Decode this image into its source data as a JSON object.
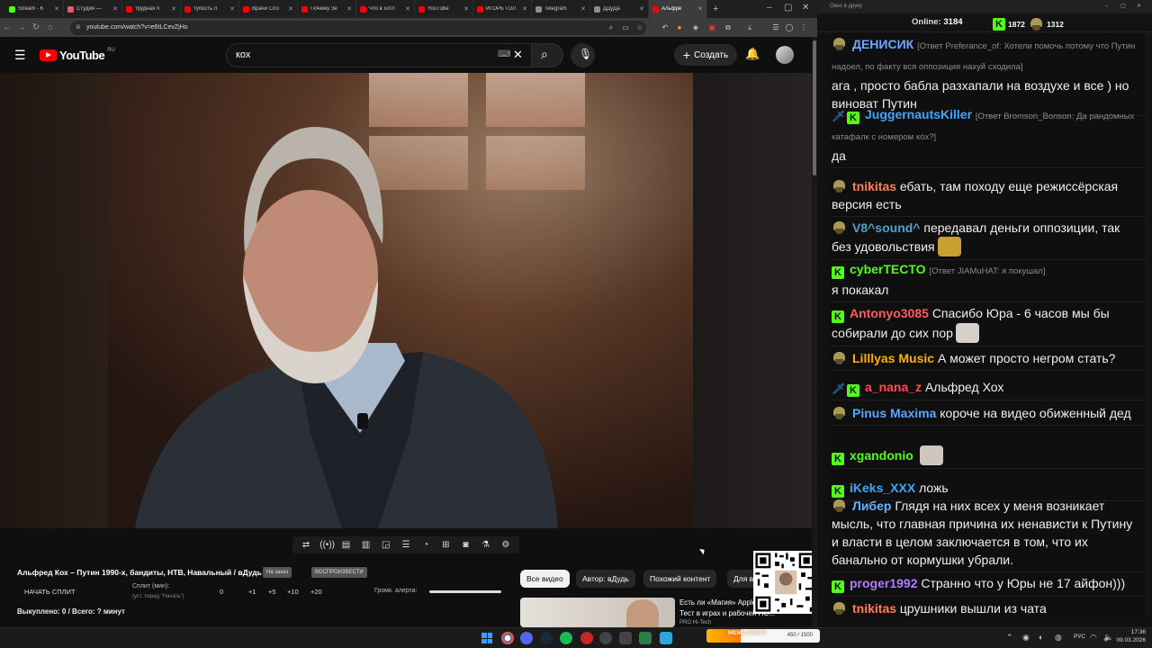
{
  "browser": {
    "tabs": [
      {
        "title": "Stream - K",
        "color": "#53fc18"
      },
      {
        "title": "Студия — ",
        "color": "#ff4d6d"
      },
      {
        "title": "трудная п",
        "color": "#ff0000"
      },
      {
        "title": "тупость п",
        "color": "#ff0000"
      },
      {
        "title": "Врачи Сло",
        "color": "#ff0000"
      },
      {
        "title": "Почему Зе",
        "color": "#ff0000"
      },
      {
        "title": "Что в хотл",
        "color": "#ff0000"
      },
      {
        "title": "YouTube",
        "color": "#ff0000"
      },
      {
        "title": "ИГОРЬ ГОЛ",
        "color": "#ff0000"
      },
      {
        "title": "Telegram",
        "color": "#8c8c8c"
      },
      {
        "title": "ДДуДа",
        "color": "#8c8c8c"
      },
      {
        "title": "Альфре",
        "color": "#ff0000",
        "active": true
      }
    ],
    "new_tab": "+",
    "url": "youtube.com/watch?v=e6tLCevZjHo"
  },
  "youtube": {
    "logo_word": "YouTube",
    "logo_region": "RU",
    "search_value": "кох",
    "create_label": "Создать",
    "video_title": "Альфред Кох – Путин 1990-х, бандиты, НТВ, Навальный / вДудь",
    "pill_1": "На заказ",
    "pill_2": "ВОСПРОИЗВЕСТИ",
    "split_start": "НАЧАТЬ СПЛИТ",
    "split_label": "Сплит (мин):",
    "split_hint": "(уст. перед \"Начать\")",
    "split_values": [
      "0",
      "+1",
      "+5",
      "+10",
      "+20"
    ],
    "volume_label": "Громк. алерта:",
    "volume_level": 1.0,
    "bought": "Выкуплено: 0 / Всего: ? минут",
    "chips": [
      "Все видео",
      "Автор: вДудь",
      "Похожий контент",
      "Для в"
    ],
    "rec_title": "Есть ли «Магия» Apple?",
    "rec_subtitle": "Тест в играх и рабочей ПО...",
    "rec_channel": "PRO Hi-Tech"
  },
  "chat": {
    "window_title": "Окно в друку",
    "online_label": "Online:",
    "online_count": "3184",
    "kick_count": "1872",
    "other_count": "1312",
    "messages": [
      {
        "badges": [
          "m"
        ],
        "nick": "ДЕНИСИК",
        "color": "#6ea9ff",
        "reply": "[Ответ Preferance_of: Хотели помочь потому что Путин надоел, по факту вся оппозиция нахуй сходила]",
        "text": "ага , просто бабла разхапали на воздухе и все ) но виноват Путин"
      },
      {
        "badges": [
          "s",
          "k"
        ],
        "nick": "JuggernautsKiller",
        "color": "#3ea6ff",
        "reply": "[Ответ Bromson_Bonson: Да рандомных катафалк с номером кох?]",
        "text": "да"
      },
      {
        "badges": [
          "m"
        ],
        "nick": "tnikitas",
        "color": "#ff7f50",
        "text": "ебать, там походу еще режиссёрская версия есть"
      },
      {
        "badges": [
          "m"
        ],
        "nick": "V8^sound^",
        "color": "#4fa3c7",
        "text": "передавал деньги оппозиции, так без удовольствия",
        "emote": "#c8a030"
      },
      {
        "badges": [
          "k"
        ],
        "nick": "cyberTECTO",
        "color": "#53fc18",
        "reply": "[Ответ JIAMuHAT: я покушал]",
        "text": "я покакал"
      },
      {
        "badges": [
          "k"
        ],
        "nick": "Antonyo3085",
        "color": "#ff5a5a",
        "text": "Спасибо Юра - 6 часов мы бы собирали до сих пор",
        "emote": "#d6d0c8"
      },
      {
        "badges": [
          "m"
        ],
        "nick": "Lilllyas Music",
        "color": "#ffb000",
        "text": "А может просто негром стать?"
      },
      {
        "badges": [
          "s",
          "k"
        ],
        "nick": "a_nana_z",
        "color": "#ff4d4d",
        "text": "Альфред Хох"
      },
      {
        "badges": [
          "m"
        ],
        "nick": "Pinus Maxima",
        "color": "#57a6ff",
        "text": "короче на видео обиженный дед"
      },
      {
        "badges": [
          "k"
        ],
        "nick": "xgandonio",
        "color": "#53fc18",
        "text": "",
        "emote": "#cfc6bd"
      },
      {
        "badges": [
          "k"
        ],
        "nick": "iKeks_XXX",
        "color": "#3ea6ff",
        "text": "ложь"
      },
      {
        "badges": [
          "m"
        ],
        "nick": "Либер",
        "color": "#66b2ff",
        "text": "Глядя на них всех у меня возникает мысль, что главная причина их ненависти к Путину и власти в целом заключается в том, что их банально от кормушки убрали."
      },
      {
        "badges": [
          "k"
        ],
        "nick": "proger1992",
        "color": "#b07cff",
        "text": "Странно что у Юры не 17 айфон)))"
      },
      {
        "badges": [
          "m"
        ],
        "nick": "tnikitas",
        "color": "#ff7f50",
        "text": "црушники вышли из чата"
      }
    ]
  },
  "taskbar": {
    "meme_label": "MEME PARTY",
    "meme_count": "450 / 1500",
    "meme_progress": 0.3,
    "lang": "РУС",
    "time": "17:36",
    "date": "09.03.2026"
  },
  "colors": {
    "kick_green": "#53fc18",
    "yt_red": "#ff0000",
    "chat_bg": "#0f0f0f"
  }
}
